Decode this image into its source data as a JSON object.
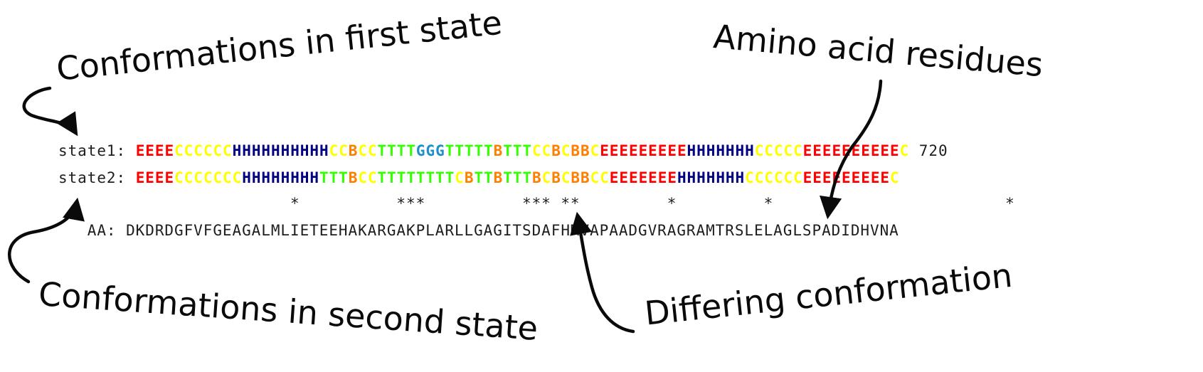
{
  "annotations": {
    "first_state": "Conformations in first state",
    "second_state": "Conformations in second state",
    "amino_acid": "Amino acid residues",
    "differing": "Differing conformation"
  },
  "alignment": {
    "state1": {
      "label": "state1:",
      "sequence": "EEEECCCCCCHHHHHHHHHHCCBCCTTTTGGGTTTTTBTTTCCBCBBCEEEEEEEEEHHHHHHHCCCCCEEEEEEEEEEC",
      "position": "720"
    },
    "state2": {
      "label": "state2:",
      "sequence": "EEEECCCCCCCHHHHHHHHTTTBCCTTTTTTTTCBTTBTTTBCBCBBCCEEEEEEEHHHHHHHCCCCCCEEEEEEEEEC"
    },
    "differences": "                        *          ***          *** **         *         *                        *  ",
    "aa": {
      "label": "AA:",
      "sequence": "DKDRDGFVFGEAGALMLIETEEHAKARGAKPLARLLGAGITSDAFHMVAPAADGVRAGRAMTRSLELAGLSPADIDHVNA"
    }
  },
  "colors": {
    "E": "#ff0000",
    "C": "#ffff00",
    "H": "#000080",
    "T": "#33ff00",
    "B": "#ff7f00",
    "G": "#1e90c8"
  }
}
